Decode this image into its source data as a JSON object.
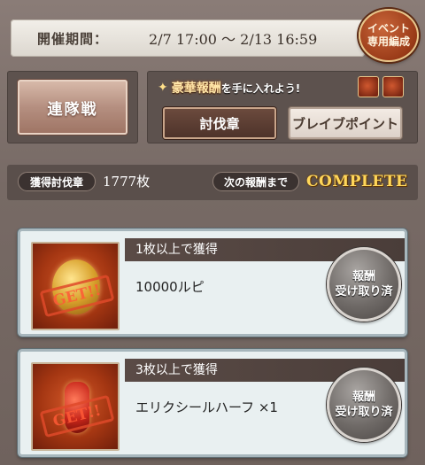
{
  "header": {
    "period_label": "開催期間：",
    "period_value": "2/7 17:00 〜 2/13 16:59",
    "event_badge_line1": "イベント",
    "event_badge_line2": "専用編成"
  },
  "left_panel": {
    "button_label": "連隊戦"
  },
  "right_panel": {
    "banner_main": "豪華報酬",
    "banner_sub": "を手に入れよう!",
    "tabs": [
      {
        "label": "討伐章",
        "active": true
      },
      {
        "label": "ブレイブポイント",
        "active": false
      }
    ]
  },
  "status": {
    "count_label": "獲得討伐章",
    "count_value": "1777枚",
    "next_label": "次の報酬まで",
    "next_value": "COMPLETE"
  },
  "rewards": [
    {
      "requirement": "1枚以上で獲得",
      "reward": "10000ルピ",
      "stamp": "GET!!",
      "icon": "rupie-coins-icon",
      "claim_line1": "報酬",
      "claim_line2": "受け取り済"
    },
    {
      "requirement": "3枚以上で獲得",
      "reward": "エリクシールハーフ ×1",
      "stamp": "GET!!",
      "icon": "elixir-half-icon",
      "claim_line1": "報酬",
      "claim_line2": "受け取り済"
    }
  ],
  "colors": {
    "complete": "#ffd75a",
    "stamp": "#e04a2a",
    "badge": "#9a3b18"
  }
}
